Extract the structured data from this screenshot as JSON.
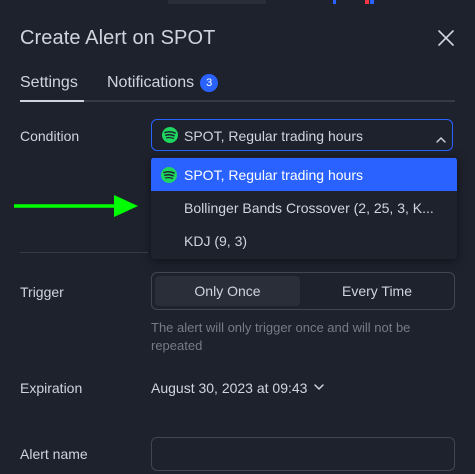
{
  "dialog": {
    "title": "Create Alert on SPOT",
    "close_icon": "close-icon"
  },
  "tabs": [
    {
      "label": "Settings",
      "active": true
    },
    {
      "label": "Notifications",
      "badge": "3",
      "active": false
    }
  ],
  "condition": {
    "label": "Condition",
    "selected": "SPOT, Regular trading hours",
    "icon": "spotify-logo-icon",
    "options": [
      {
        "label": "SPOT, Regular trading hours",
        "icon": "spotify-logo-icon",
        "highlighted": true
      },
      {
        "label": "Bollinger Bands Crossover (2, 25, 3, K..."
      },
      {
        "label": "KDJ (9, 3)"
      }
    ]
  },
  "annotation": {
    "arrow_color": "#00ff00",
    "arrow_icon": "right-arrow-icon"
  },
  "trigger": {
    "label": "Trigger",
    "options": [
      "Only Once",
      "Every Time"
    ],
    "selected": "Only Once",
    "hint": "The alert will only trigger once and will not be repeated"
  },
  "expiration": {
    "label": "Expiration",
    "value": "August 30, 2023 at 09:43"
  },
  "alert_name": {
    "label": "Alert name",
    "value": "",
    "placeholder": ""
  },
  "colors": {
    "background": "#1e222d",
    "accent": "#2962ff",
    "text": "#d1d4dc",
    "muted": "#787b86",
    "border": "#434651",
    "spotify_green": "#1ed760"
  }
}
